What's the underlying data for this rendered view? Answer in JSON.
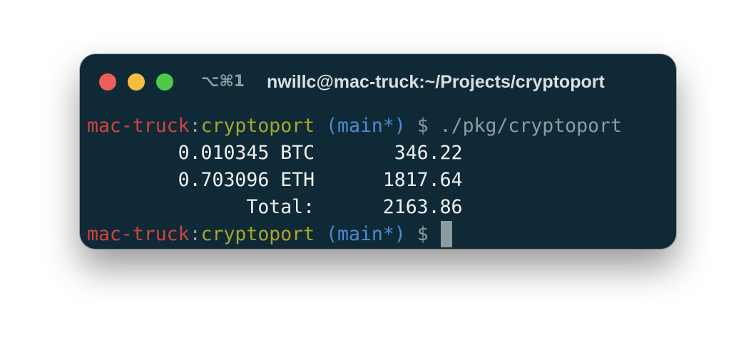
{
  "window": {
    "shortcut": "⌥⌘1",
    "title": "nwillc@mac-truck:~/Projects/cryptoport",
    "traffic_lights": {
      "close": "#ee5f59",
      "minimize": "#f6bd42",
      "zoom": "#4ec94a"
    }
  },
  "colors": {
    "background": "#0f2a36",
    "host": "#d0453f",
    "directory": "#a9a42d",
    "branch": "#4e8bd0",
    "dim": "#8d9ca3",
    "text": "#eef1f2"
  },
  "prompt": {
    "host": "mac-truck",
    "separator": ":",
    "directory": "cryptoport",
    "branch": "(main*)",
    "symbol": "$"
  },
  "terminal": {
    "command": "./pkg/cryptoport",
    "output": [
      "        0.010345 BTC       346.22",
      "        0.703096 ETH      1817.64",
      "              Total:      2163.86"
    ]
  }
}
